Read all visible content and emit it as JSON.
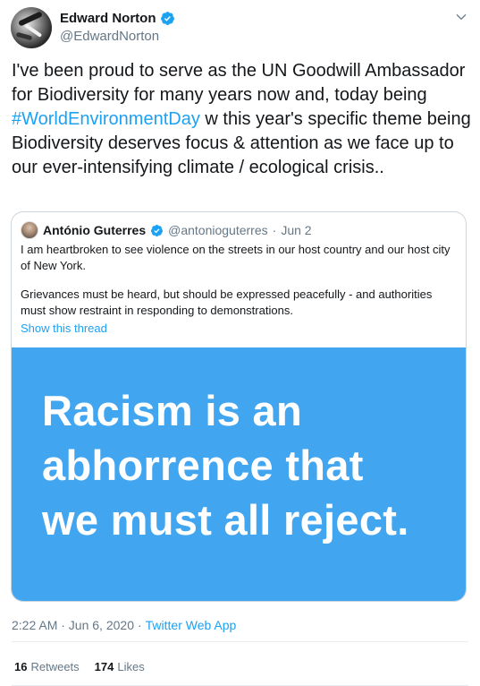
{
  "author": {
    "name": "Edward Norton",
    "handle": "@EdwardNorton",
    "verified": true
  },
  "tweet": {
    "text_before": "I've been proud to serve as the UN Goodwill Ambassador for Biodiversity for many years now and, today being ",
    "hashtag": "#WorldEnvironmentDay",
    "text_after": " w this year's specific theme being Biodiversity deserves focus & attention as we face up to our ever-intensifying climate / ecological crisis.."
  },
  "quoted": {
    "name": "António Guterres",
    "handle": "@antonioguterres",
    "separator": "·",
    "date": "Jun 2",
    "paragraph1": "I am heartbroken to see violence on the streets in our host country and our host city of New York.",
    "paragraph2": "Grievances must be heard, but should be expressed peacefully - and authorities must show restraint in responding to demonstrations.",
    "show_thread": "Show this thread",
    "image_lines": [
      "Racism is an",
      "abhorrence that",
      "we must all reject."
    ]
  },
  "meta": {
    "timestamp": "2:22 AM · Jun 6, 2020",
    "separator": "·",
    "source": "Twitter Web App"
  },
  "stats": {
    "retweets_count": "16",
    "retweets_label": "Retweets",
    "likes_count": "174",
    "likes_label": "Likes"
  },
  "colors": {
    "accent": "#1da1f2",
    "image_bg": "#42a5f0",
    "secondary_text": "#657786"
  },
  "icons": [
    "verified-badge-icon",
    "chevron-down-icon"
  ]
}
